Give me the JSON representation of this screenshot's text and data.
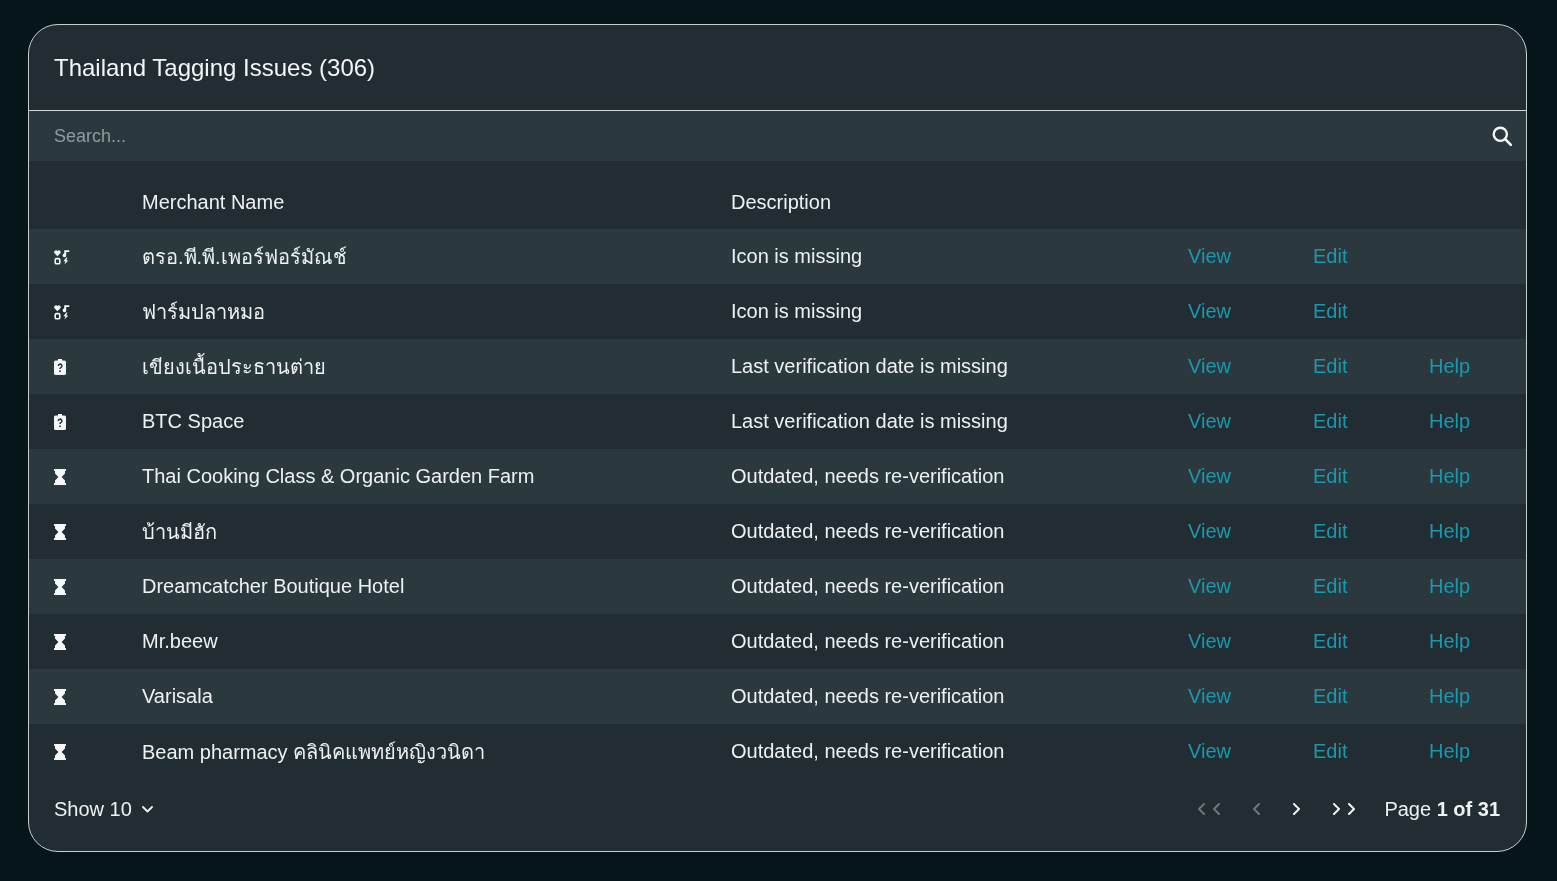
{
  "panel": {
    "title": "Thailand Tagging Issues (306)"
  },
  "search": {
    "placeholder": "Search..."
  },
  "table": {
    "columns": [
      "Merchant Name",
      "Description"
    ],
    "rows": [
      {
        "kind": "icon_missing",
        "merchant": "ตรอ.พี.พี.เพอร์ฟอร์มัณช์",
        "description": "Icon is missing",
        "actions": [
          "View",
          "Edit"
        ]
      },
      {
        "kind": "icon_missing",
        "merchant": "ฟาร์มปลาหมอ",
        "description": "Icon is missing",
        "actions": [
          "View",
          "Edit"
        ]
      },
      {
        "kind": "date_missing",
        "merchant": "เขียงเนื้อประธานต่าย",
        "description": "Last verification date is missing",
        "actions": [
          "View",
          "Edit",
          "Help"
        ]
      },
      {
        "kind": "date_missing",
        "merchant": "BTC Space",
        "description": "Last verification date is missing",
        "actions": [
          "View",
          "Edit",
          "Help"
        ]
      },
      {
        "kind": "outdated",
        "merchant": "Thai Cooking Class & Organic Garden Farm",
        "description": "Outdated, needs re-verification",
        "actions": [
          "View",
          "Edit",
          "Help"
        ]
      },
      {
        "kind": "outdated",
        "merchant": "บ้านมีฮัก",
        "description": "Outdated, needs re-verification",
        "actions": [
          "View",
          "Edit",
          "Help"
        ]
      },
      {
        "kind": "outdated",
        "merchant": "Dreamcatcher Boutique Hotel",
        "description": "Outdated, needs re-verification",
        "actions": [
          "View",
          "Edit",
          "Help"
        ]
      },
      {
        "kind": "outdated",
        "merchant": "Mr.beew",
        "description": "Outdated, needs re-verification",
        "actions": [
          "View",
          "Edit",
          "Help"
        ]
      },
      {
        "kind": "outdated",
        "merchant": "Varisala",
        "description": "Outdated, needs re-verification",
        "actions": [
          "View",
          "Edit",
          "Help"
        ]
      },
      {
        "kind": "outdated",
        "merchant": "Beam pharmacy คลินิคแพทย์หญิงวนิดา",
        "description": "Outdated, needs re-verification",
        "actions": [
          "View",
          "Edit",
          "Help"
        ]
      }
    ]
  },
  "footer": {
    "page_size": "Show 10",
    "pagination": {
      "buttons": [
        {
          "kind": "first",
          "disabled": true
        },
        {
          "kind": "previous",
          "disabled": true
        },
        {
          "kind": "next",
          "disabled": false
        },
        {
          "kind": "last",
          "disabled": false
        }
      ],
      "label": "Page **1 of 31**"
    }
  }
}
